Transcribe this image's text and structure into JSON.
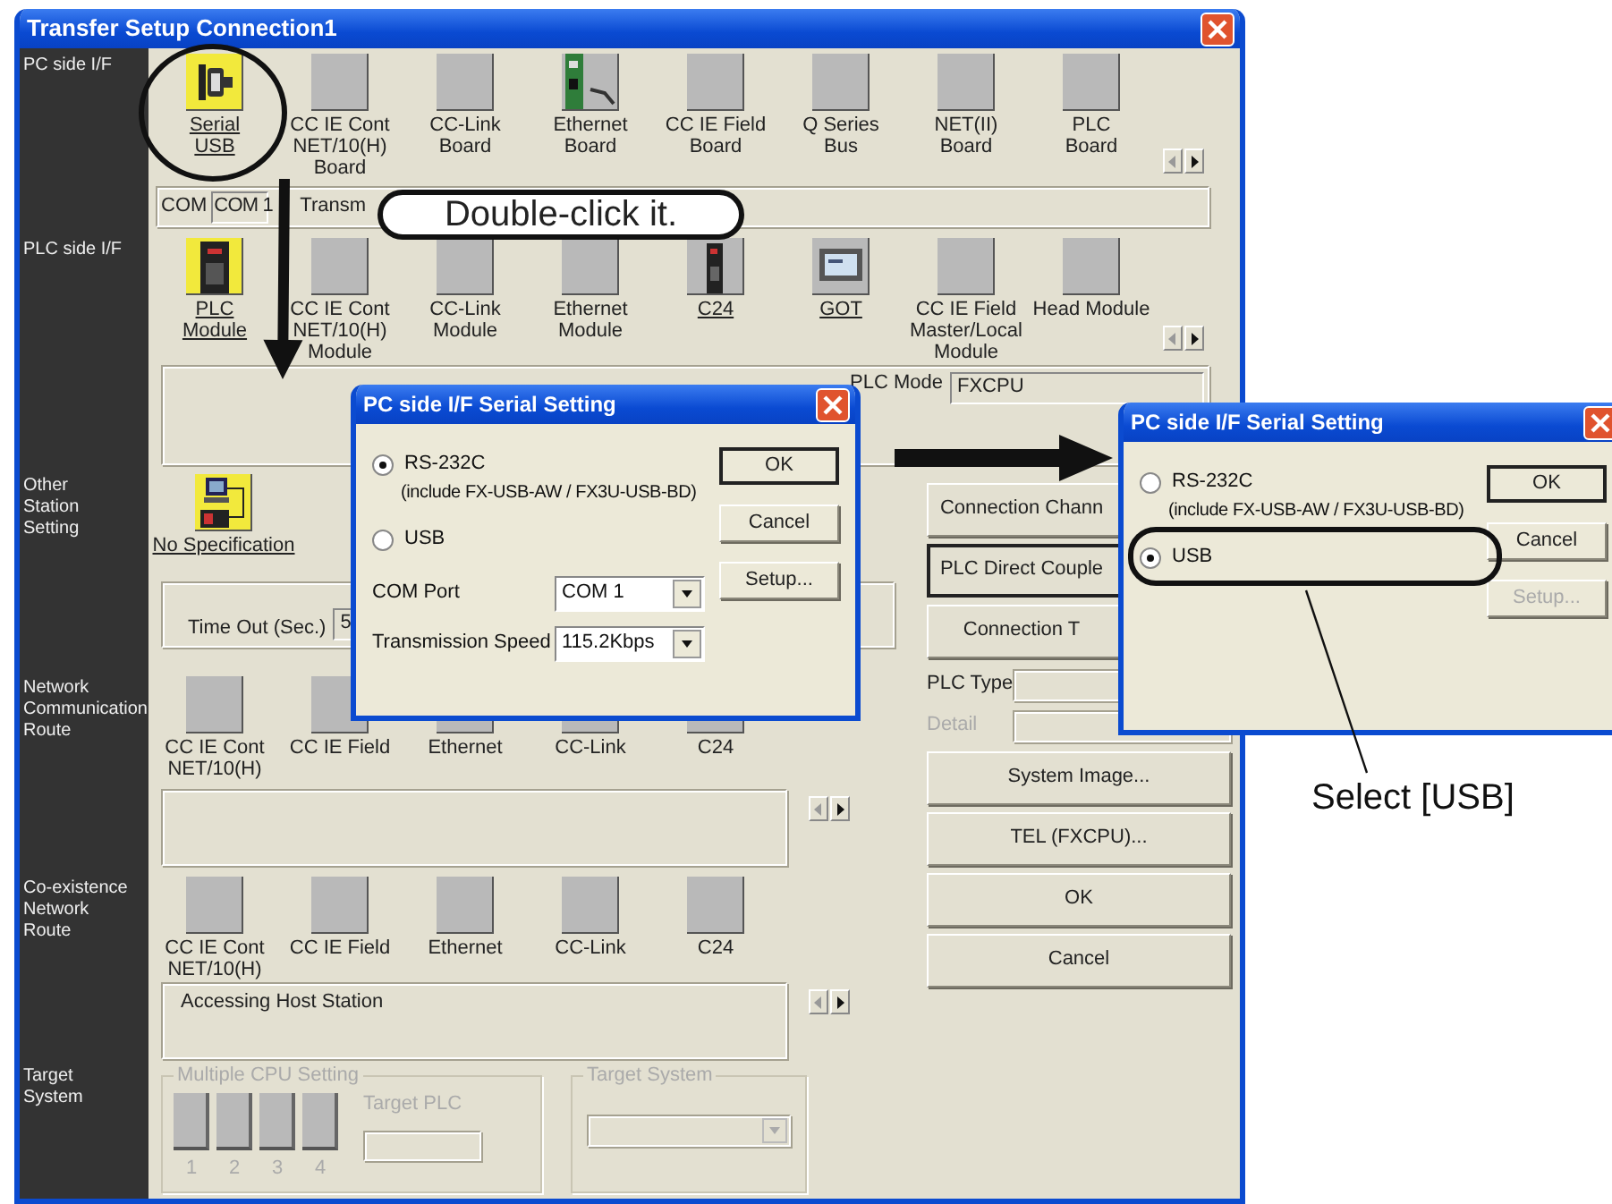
{
  "window": {
    "title": "Transfer Setup Connection1"
  },
  "pc_side": {
    "label": "PC side I/F",
    "items": [
      {
        "label": "Serial\nUSB",
        "kind": "serial",
        "selected": true,
        "linked": true
      },
      {
        "label": "CC IE Cont\nNET/10(H)\nBoard",
        "kind": "blank",
        "selected": false,
        "linked": false
      },
      {
        "label": "CC-Link\nBoard",
        "kind": "blank",
        "selected": false,
        "linked": false
      },
      {
        "label": "Ethernet\nBoard",
        "kind": "board",
        "selected": false,
        "linked": false
      },
      {
        "label": "CC IE Field\nBoard",
        "kind": "blank",
        "selected": false,
        "linked": false
      },
      {
        "label": "Q Series\nBus",
        "kind": "blank",
        "selected": false,
        "linked": false
      },
      {
        "label": "NET(II)\nBoard",
        "kind": "blank",
        "selected": false,
        "linked": false
      },
      {
        "label": "PLC\nBoard",
        "kind": "blank",
        "selected": false,
        "linked": false
      }
    ],
    "com_label": "COM",
    "com_value": "COM 1",
    "speed_label": "Transm"
  },
  "plc_side": {
    "label": "PLC side I/F",
    "items": [
      {
        "label": "PLC\nModule",
        "kind": "plc",
        "selected": true,
        "linked": true
      },
      {
        "label": "CC IE Cont\nNET/10(H)\nModule",
        "kind": "blank",
        "selected": false,
        "linked": false
      },
      {
        "label": "CC-Link\nModule",
        "kind": "blank",
        "selected": false,
        "linked": false
      },
      {
        "label": "Ethernet\nModule",
        "kind": "blank",
        "selected": false,
        "linked": false
      },
      {
        "label": "C24",
        "kind": "c24",
        "selected": false,
        "linked": true
      },
      {
        "label": "GOT",
        "kind": "got",
        "selected": false,
        "linked": true
      },
      {
        "label": "CC IE Field\nMaster/Local\nModule",
        "kind": "blank",
        "selected": false,
        "linked": false
      },
      {
        "label": "Head Module",
        "kind": "blank",
        "selected": false,
        "linked": false
      }
    ],
    "plc_mode_label": "PLC Mode",
    "plc_mode_value": "FXCPU"
  },
  "other_station": {
    "label": "Other\nStation\nSetting",
    "item": {
      "label": "No Specification",
      "kind": "station",
      "selected": true,
      "linked": true
    },
    "timeout_label": "Time Out (Sec.)",
    "timeout_value": "5"
  },
  "network_route": {
    "label": "Network\nCommunication\nRoute",
    "items": [
      {
        "label": "CC IE Cont\nNET/10(H)"
      },
      {
        "label": "CC IE Field"
      },
      {
        "label": "Ethernet"
      },
      {
        "label": "CC-Link"
      },
      {
        "label": "C24"
      }
    ]
  },
  "coexistence_route": {
    "label": "Co-existence\nNetwork\nRoute",
    "items": [
      {
        "label": "CC IE Cont\nNET/10(H)"
      },
      {
        "label": "CC IE Field"
      },
      {
        "label": "Ethernet"
      },
      {
        "label": "CC-Link"
      },
      {
        "label": "C24"
      }
    ],
    "message": "Accessing Host Station"
  },
  "target_system": {
    "label": "Target\nSystem",
    "multiple_cpu_title": "Multiple CPU Setting",
    "slots": [
      "1",
      "2",
      "3",
      "4"
    ],
    "target_plc_label": "Target PLC",
    "target_system_title": "Target System"
  },
  "side_buttons_top": [
    {
      "label": "Connection Chann",
      "default": false
    },
    {
      "label": "PLC Direct Couple",
      "default": true
    },
    {
      "label": "Connection T",
      "default": false
    }
  ],
  "plc_type_label": "PLC Type",
  "detail_label": "Detail",
  "side_buttons_bottom": [
    {
      "label": "System Image...",
      "default": false
    },
    {
      "label": "TEL (FXCPU)...",
      "default": false
    },
    {
      "label": "OK",
      "default": false
    },
    {
      "label": "Cancel",
      "default": false
    }
  ],
  "dialogs": [
    {
      "title": "PC side I/F Serial Setting",
      "rows": [
        {
          "kind": "radio",
          "label": "RS-232C",
          "selected": true
        },
        {
          "kind": "note",
          "text": "(include FX-USB-AW / FX3U-USB-BD)"
        },
        {
          "kind": "radio",
          "label": "USB",
          "selected": false
        },
        {
          "kind": "select",
          "label": "COM Port",
          "value": "COM 1"
        },
        {
          "kind": "select",
          "label": "Transmission Speed",
          "value": "115.2Kbps"
        }
      ],
      "buttons": [
        {
          "label": "OK",
          "default": true,
          "disabled": false
        },
        {
          "label": "Cancel",
          "default": false,
          "disabled": false
        },
        {
          "label": "Setup...",
          "default": false,
          "disabled": false
        }
      ]
    },
    {
      "title": "PC side I/F Serial Setting",
      "rows": [
        {
          "kind": "radio",
          "label": "RS-232C",
          "selected": false
        },
        {
          "kind": "note",
          "text": "(include FX-USB-AW / FX3U-USB-BD)"
        },
        {
          "kind": "radio",
          "label": "USB",
          "selected": true
        }
      ],
      "buttons": [
        {
          "label": "OK",
          "default": true,
          "disabled": false
        },
        {
          "label": "Cancel",
          "default": false,
          "disabled": false
        },
        {
          "label": "Setup...",
          "default": false,
          "disabled": true
        }
      ]
    }
  ],
  "annotations": {
    "callout": "Double-click it.",
    "note": "Select [USB]"
  }
}
